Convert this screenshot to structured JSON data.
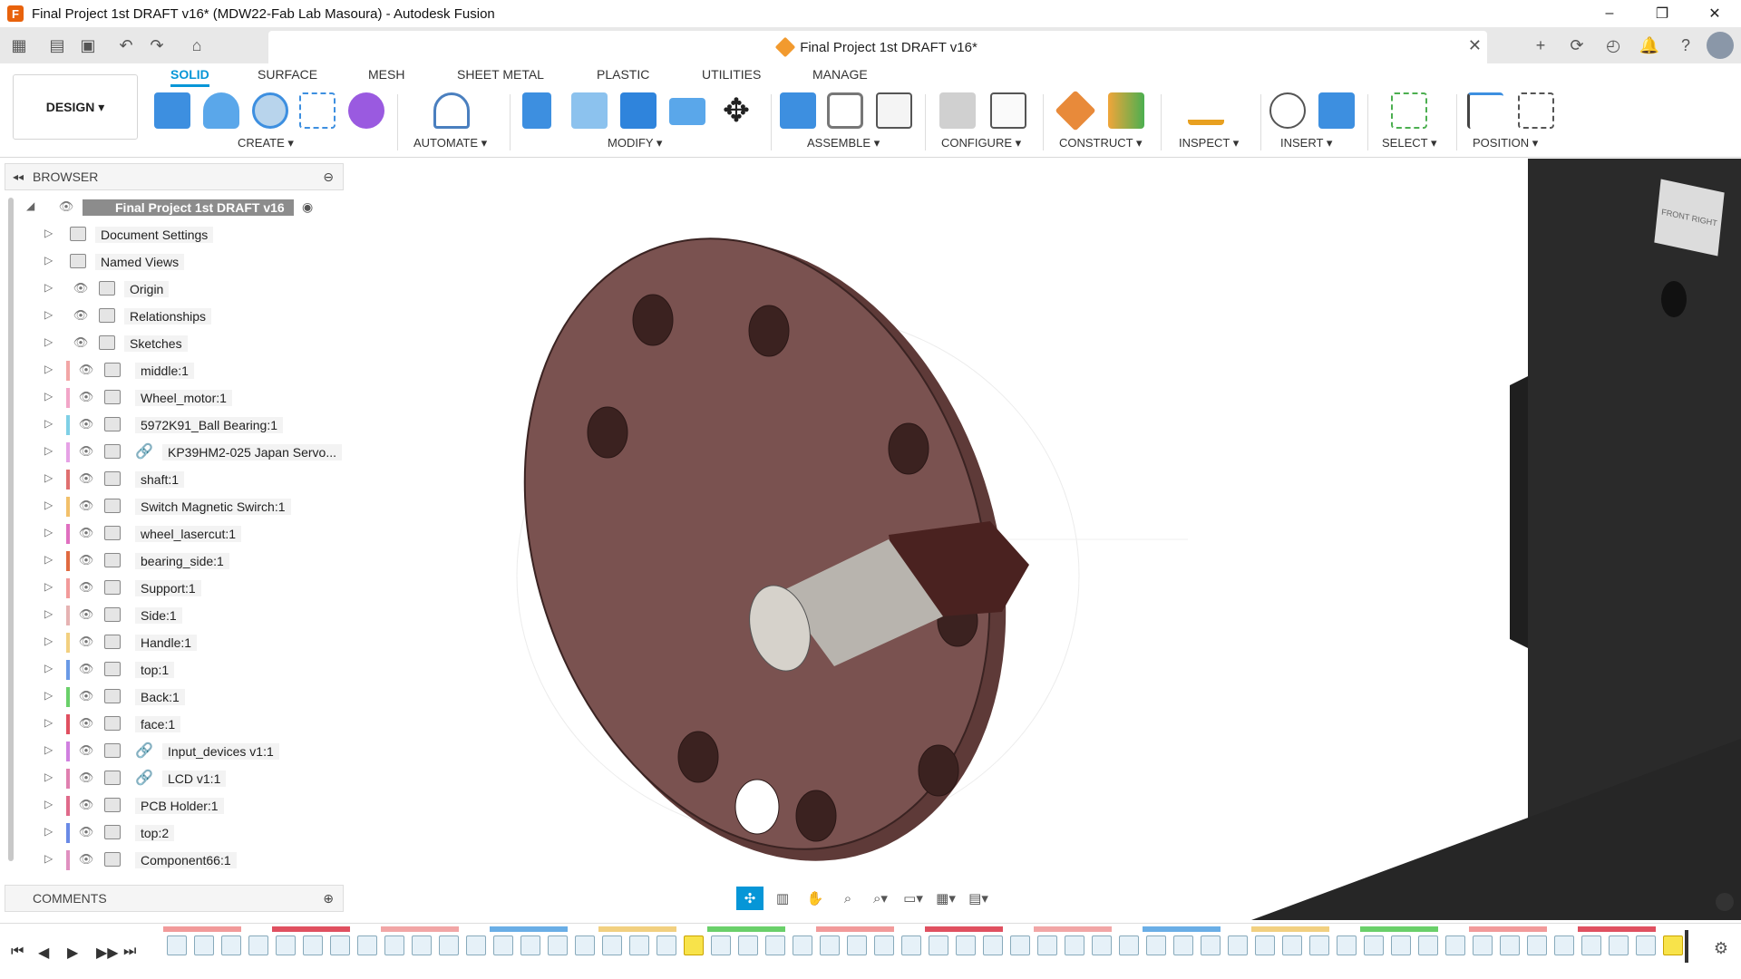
{
  "window": {
    "title": "Final Project 1st DRAFT v16* (MDW22-Fab Lab Masoura) - Autodesk Fusion",
    "app_icon": "F",
    "minimize": "–",
    "restore": "❐",
    "close": "✕"
  },
  "tab": {
    "title": "Final Project 1st DRAFT v16*",
    "close": "✕"
  },
  "ribbon": {
    "workspace": "DESIGN ▾",
    "tabs": [
      "SOLID",
      "SURFACE",
      "MESH",
      "SHEET METAL",
      "PLASTIC",
      "UTILITIES",
      "MANAGE"
    ],
    "groups": [
      "CREATE ▾",
      "AUTOMATE ▾",
      "MODIFY ▾",
      "ASSEMBLE ▾",
      "CONFIGURE ▾",
      "CONSTRUCT ▾",
      "INSPECT ▾",
      "INSERT ▾",
      "SELECT ▾",
      "POSITION ▾"
    ]
  },
  "browser": {
    "title": "BROWSER",
    "root": "Final Project 1st DRAFT v16",
    "items": [
      {
        "label": "Document Settings",
        "color": ""
      },
      {
        "label": "Named Views",
        "color": ""
      },
      {
        "label": "Origin",
        "color": ""
      },
      {
        "label": "Relationships",
        "color": ""
      },
      {
        "label": "Sketches",
        "color": ""
      },
      {
        "label": "middle:1",
        "color": "#f2a6a6"
      },
      {
        "label": "Wheel_motor:1",
        "color": "#f2a6c8"
      },
      {
        "label": "5972K91_Ball Bearing:1",
        "color": "#7fd0e6"
      },
      {
        "label": "KP39HM2-025 Japan Servo...",
        "color": "#e6a2e6"
      },
      {
        "label": "shaft:1",
        "color": "#e07070"
      },
      {
        "label": "Switch Magnetic Swirch:1",
        "color": "#f2c06a"
      },
      {
        "label": "wheel_lasercut:1",
        "color": "#e070c0"
      },
      {
        "label": "bearing_side:1",
        "color": "#e06a40"
      },
      {
        "label": "Support:1",
        "color": "#f29a9a"
      },
      {
        "label": "Side:1",
        "color": "#e6b3b3"
      },
      {
        "label": "Handle:1",
        "color": "#f2d080"
      },
      {
        "label": "top:1",
        "color": "#6a9ae6"
      },
      {
        "label": "Back:1",
        "color": "#6ad06a"
      },
      {
        "label": "face:1",
        "color": "#e05060"
      },
      {
        "label": "Input_devices v1:1",
        "color": "#d080e0"
      },
      {
        "label": "LCD v1:1",
        "color": "#e080b0"
      },
      {
        "label": "PCB Holder:1",
        "color": "#e06a8a"
      },
      {
        "label": "top:2",
        "color": "#6a8ae6"
      },
      {
        "label": "Component66:1",
        "color": "#e090c0"
      }
    ]
  },
  "comments": {
    "title": "COMMENTS"
  },
  "viewcube": {
    "faces": "FRONT RIGHT"
  }
}
